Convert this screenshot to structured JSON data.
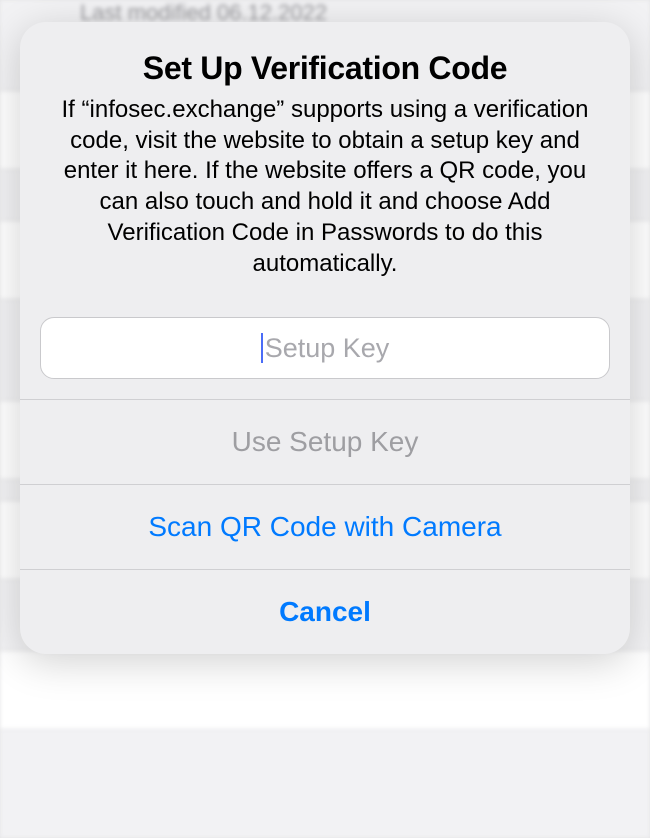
{
  "backdrop": {
    "modified": "Last modified 06.12.2022"
  },
  "alert": {
    "title": "Set Up Verification Code",
    "message": "If “infosec.exchange” supports using a verification code, visit the website to obtain a setup key and enter it here. If the website offers a QR code, you can also touch and hold it and choose Add Verification Code in Passwords to do this automatically.",
    "input": {
      "placeholder": "Setup Key",
      "value": ""
    },
    "actions": {
      "use_setup_key": "Use Setup Key",
      "scan_qr": "Scan QR Code with Camera",
      "cancel": "Cancel"
    }
  }
}
